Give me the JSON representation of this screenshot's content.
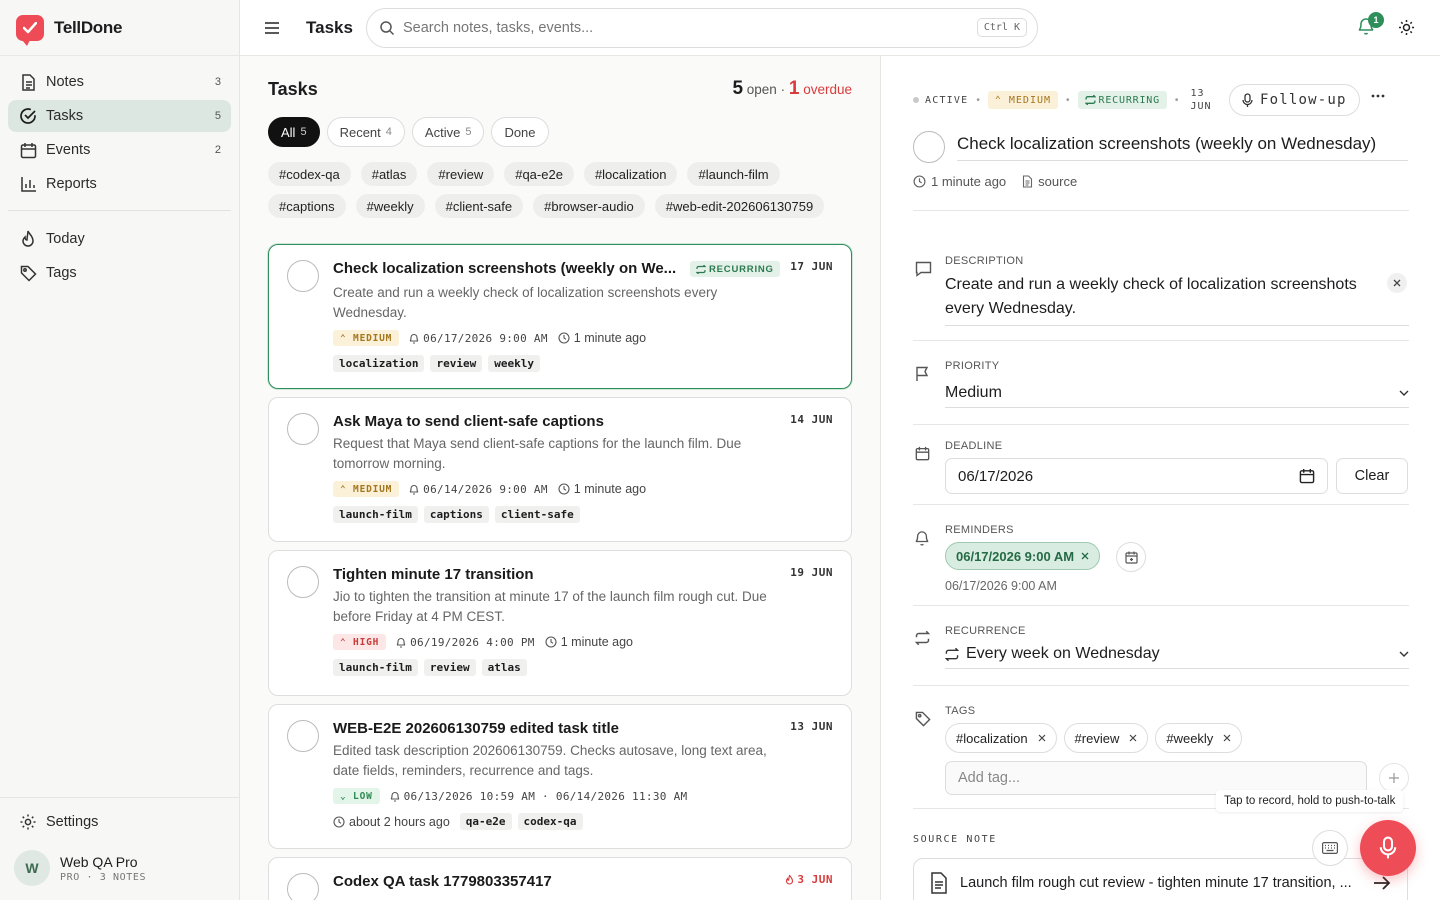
{
  "app": {
    "name": "TellDone"
  },
  "sidebar": {
    "items": [
      {
        "label": "Notes",
        "count": "3"
      },
      {
        "label": "Tasks",
        "count": "5"
      },
      {
        "label": "Events",
        "count": "2"
      },
      {
        "label": "Reports",
        "count": ""
      }
    ],
    "secondary": [
      {
        "label": "Today"
      },
      {
        "label": "Tags"
      }
    ],
    "settings_label": "Settings",
    "user": {
      "initial": "W",
      "name": "Web QA Pro",
      "plan": "PRO · 3 NOTES"
    }
  },
  "topbar": {
    "title": "Tasks",
    "search_placeholder": "Search notes, tasks, events...",
    "shortcut": "Ctrl K",
    "notification_count": "1"
  },
  "list": {
    "title": "Tasks",
    "open_count": "5",
    "open_label": "open",
    "separator": "·",
    "overdue_count": "1",
    "overdue_label": "overdue",
    "filters": [
      {
        "label": "All",
        "count": "5"
      },
      {
        "label": "Recent",
        "count": "4"
      },
      {
        "label": "Active",
        "count": "5"
      },
      {
        "label": "Done",
        "count": ""
      }
    ],
    "tags": [
      "#codex-qa",
      "#atlas",
      "#review",
      "#qa-e2e",
      "#localization",
      "#launch-film",
      "#captions",
      "#weekly",
      "#client-safe",
      "#browser-audio",
      "#web-edit-202606130759"
    ],
    "tasks": [
      {
        "title": "Check localization screenshots (weekly on We...",
        "recurring": "RECURRING",
        "date": "17 JUN",
        "description": "Create and run a weekly check of localization screenshots every Wednesday.",
        "priority": "MEDIUM",
        "reminder": "06/17/2026 9:00 AM",
        "updated": "1 minute ago",
        "tags": [
          "localization",
          "review",
          "weekly"
        ]
      },
      {
        "title": "Ask Maya to send client-safe captions",
        "date": "14 JUN",
        "description": "Request that Maya send client-safe captions for the launch film. Due tomorrow morning.",
        "priority": "MEDIUM",
        "reminder": "06/14/2026 9:00 AM",
        "updated": "1 minute ago",
        "tags": [
          "launch-film",
          "captions",
          "client-safe"
        ]
      },
      {
        "title": "Tighten minute 17 transition",
        "date": "19 JUN",
        "description": "Jio to tighten the transition at minute 17 of the launch film rough cut. Due before Friday at 4 PM CEST.",
        "priority": "HIGH",
        "reminder": "06/19/2026 4:00 PM",
        "updated": "1 minute ago",
        "tags": [
          "launch-film",
          "review",
          "atlas"
        ]
      },
      {
        "title": "WEB-E2E 202606130759 edited task title",
        "date": "13 JUN",
        "description": "Edited task description 202606130759. Checks autosave, long text area, date fields, reminders, recurrence and tags.",
        "priority": "LOW",
        "reminder": "06/13/2026 10:59 AM · 06/14/2026 11:30 AM",
        "updated": "about 2 hours ago",
        "tags": [
          "qa-e2e",
          "codex-qa"
        ]
      },
      {
        "title": "Codex QA task 1779803357417",
        "date": "3 JUN"
      }
    ]
  },
  "detail": {
    "status": "ACTIVE",
    "priority_badge": "MEDIUM",
    "recurring_badge": "RECURRING",
    "date_day": "13",
    "date_month": "JUN",
    "follow_up": "Follow-up",
    "title": "Check localization screenshots (weekly on Wednesday)",
    "updated": "1 minute ago",
    "source_link": "source",
    "description_label": "DESCRIPTION",
    "description": "Create and run a weekly check of localization screenshots every Wednesday.",
    "priority_label": "PRIORITY",
    "priority": "Medium",
    "deadline_label": "DEADLINE",
    "deadline": "06/17/2026",
    "clear_label": "Clear",
    "reminders_label": "REMINDERS",
    "reminder_chip": "06/17/2026 9:00 AM",
    "reminder_text": "06/17/2026 9:00 AM",
    "recurrence_label": "RECURRENCE",
    "recurrence": "Every week on Wednesday",
    "tags_label": "TAGS",
    "tags": [
      "#localization",
      "#review",
      "#weekly"
    ],
    "add_tag_placeholder": "Add tag...",
    "source_note_label": "SOURCE NOTE",
    "source_note": "Launch film rough cut review - tighten minute 17 transition, ..."
  },
  "voice": {
    "tooltip": "Tap to record, hold to push-to-talk"
  },
  "colors": {
    "accent": "#2f8f5b",
    "brand": "#ef4b56",
    "danger": "#d93b3b"
  }
}
